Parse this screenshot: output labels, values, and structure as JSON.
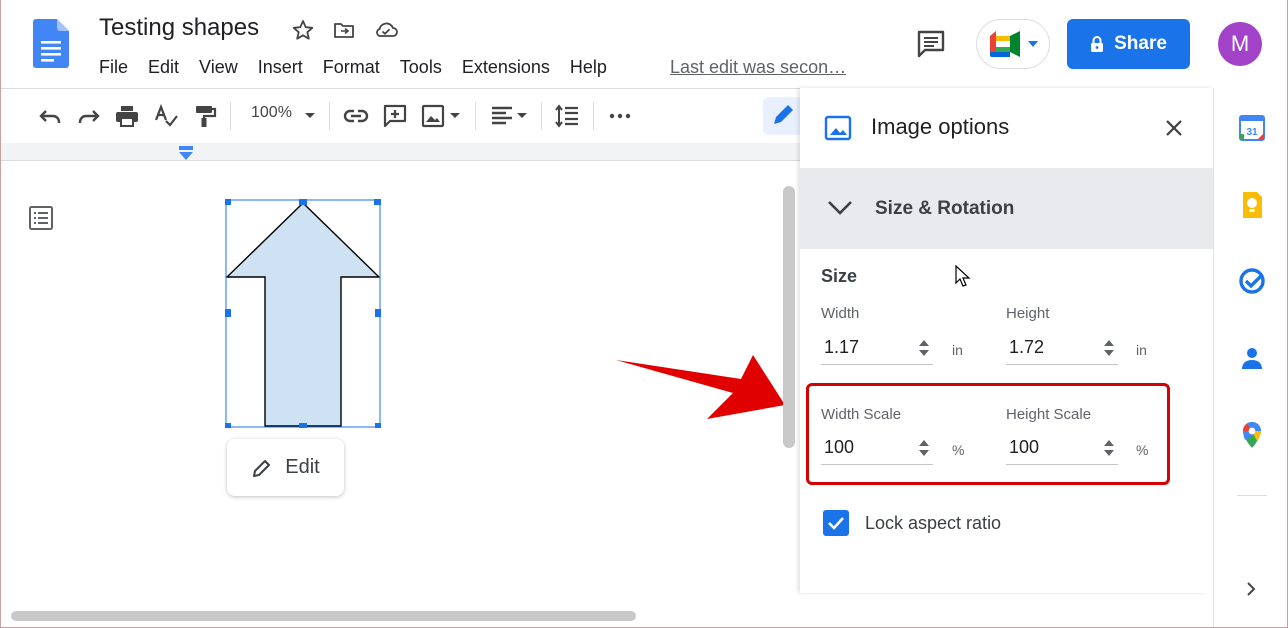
{
  "document": {
    "title": "Testing shapes",
    "last_edit": "Last edit was secon…"
  },
  "menu": [
    "File",
    "Edit",
    "View",
    "Insert",
    "Format",
    "Tools",
    "Extensions",
    "Help"
  ],
  "header": {
    "share_label": "Share",
    "avatar_initial": "M"
  },
  "toolbar": {
    "zoom": "100%"
  },
  "canvas": {
    "edit_label": "Edit"
  },
  "panel": {
    "title": "Image options",
    "section": "Size & Rotation",
    "size_heading": "Size",
    "width_label": "Width",
    "width_value": "1.17",
    "width_unit": "in",
    "height_label": "Height",
    "height_value": "1.72",
    "height_unit": "in",
    "width_scale_label": "Width Scale",
    "width_scale_value": "100",
    "width_scale_unit": "%",
    "height_scale_label": "Height Scale",
    "height_scale_value": "100",
    "height_scale_unit": "%",
    "lock_label": "Lock aspect ratio",
    "lock_checked": true
  },
  "colors": {
    "accent": "#1a73e8",
    "highlight": "#d50000",
    "shape_fill": "#cfe2f3",
    "avatar": "#a142c9"
  },
  "icons": {
    "star": "star-icon",
    "move": "move-to-folder-icon",
    "cloud": "cloud-saved-icon"
  }
}
